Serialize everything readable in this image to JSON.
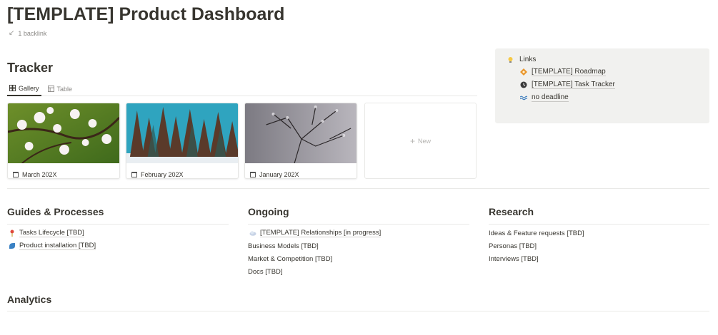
{
  "page": {
    "title": "[TEMPLATE] Product Dashboard",
    "backlink": "1 backlink"
  },
  "tracker": {
    "title": "Tracker",
    "tabs": [
      {
        "label": "Gallery",
        "active": true
      },
      {
        "label": "Table",
        "active": false
      }
    ],
    "cards": [
      {
        "label": "March 202X",
        "cover": "cherry-blossom-photo"
      },
      {
        "label": "February 202X",
        "cover": "winter-forest-photo"
      },
      {
        "label": "January 202X",
        "cover": "frosted-branches-photo"
      }
    ],
    "new_label": "New"
  },
  "links": {
    "title": "Links",
    "items": [
      {
        "label": "[TEMPLATE] Roadmap",
        "icon": "diamond-orange-icon"
      },
      {
        "label": "[TEMPLATE] Task Tracker",
        "icon": "clock-icon"
      },
      {
        "label": "no deadline",
        "icon": "waves-icon"
      }
    ]
  },
  "guides": {
    "title": "Guides & Processes",
    "items": [
      {
        "label": "Tasks Lifecycle [TBD]",
        "icon": "pin-icon"
      },
      {
        "label": "Product installation [TBD]",
        "icon": "blue-shape-icon"
      }
    ]
  },
  "ongoing": {
    "title": "Ongoing",
    "items": [
      {
        "label": "[TEMPLATE] Relationships [in progress]",
        "icon": "cloud-icon"
      },
      {
        "label": "Business Models [TBD]"
      },
      {
        "label": "Market & Competition [TBD]"
      },
      {
        "label": "Docs [TBD]"
      }
    ]
  },
  "research": {
    "title": "Research",
    "items": [
      {
        "label": "Ideas & Feature requests [TBD]"
      },
      {
        "label": "Personas [TBD]"
      },
      {
        "label": "Interviews [TBD]"
      }
    ]
  },
  "analytics": {
    "title": "Analytics"
  },
  "colors": {
    "text": "#37352f",
    "muted": "#8a8885",
    "divider": "#e9e9e7",
    "callout_bg": "#f1f1ef"
  }
}
